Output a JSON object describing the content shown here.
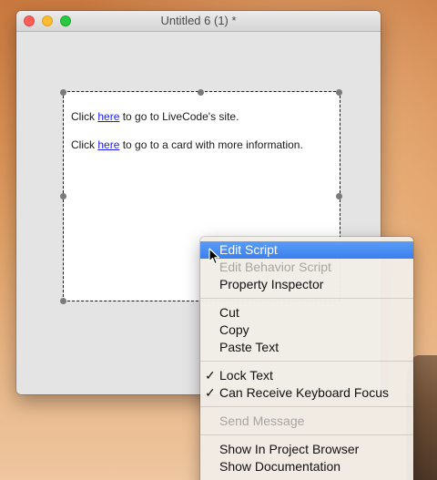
{
  "window": {
    "title": "Untitled 6 (1) *"
  },
  "field": {
    "line1": {
      "before": "Click ",
      "link": "here",
      "after": " to go to LiveCode's site."
    },
    "line2": {
      "before": "Click ",
      "link": "here",
      "after": " to go to a card with more information."
    }
  },
  "context_menu": {
    "items": [
      {
        "label": "Edit Script",
        "state": "highlighted"
      },
      {
        "label": "Edit Behavior Script",
        "state": "disabled"
      },
      {
        "label": "Property Inspector",
        "state": "enabled"
      },
      {
        "label": "Cut",
        "state": "enabled"
      },
      {
        "label": "Copy",
        "state": "enabled"
      },
      {
        "label": "Paste Text",
        "state": "enabled"
      },
      {
        "label": "Lock Text",
        "state": "checked"
      },
      {
        "label": "Can Receive Keyboard Focus",
        "state": "checked"
      },
      {
        "label": "Send Message",
        "state": "disabled"
      },
      {
        "label": "Show In Project Browser",
        "state": "enabled"
      },
      {
        "label": "Show Documentation",
        "state": "enabled"
      }
    ],
    "check_glyph": "✓"
  },
  "colors": {
    "menu_highlight": "#3a7ff0",
    "link": "#1a1aff",
    "close": "#fc5f57",
    "minimize": "#fdbc2e",
    "maximize": "#28c840"
  }
}
